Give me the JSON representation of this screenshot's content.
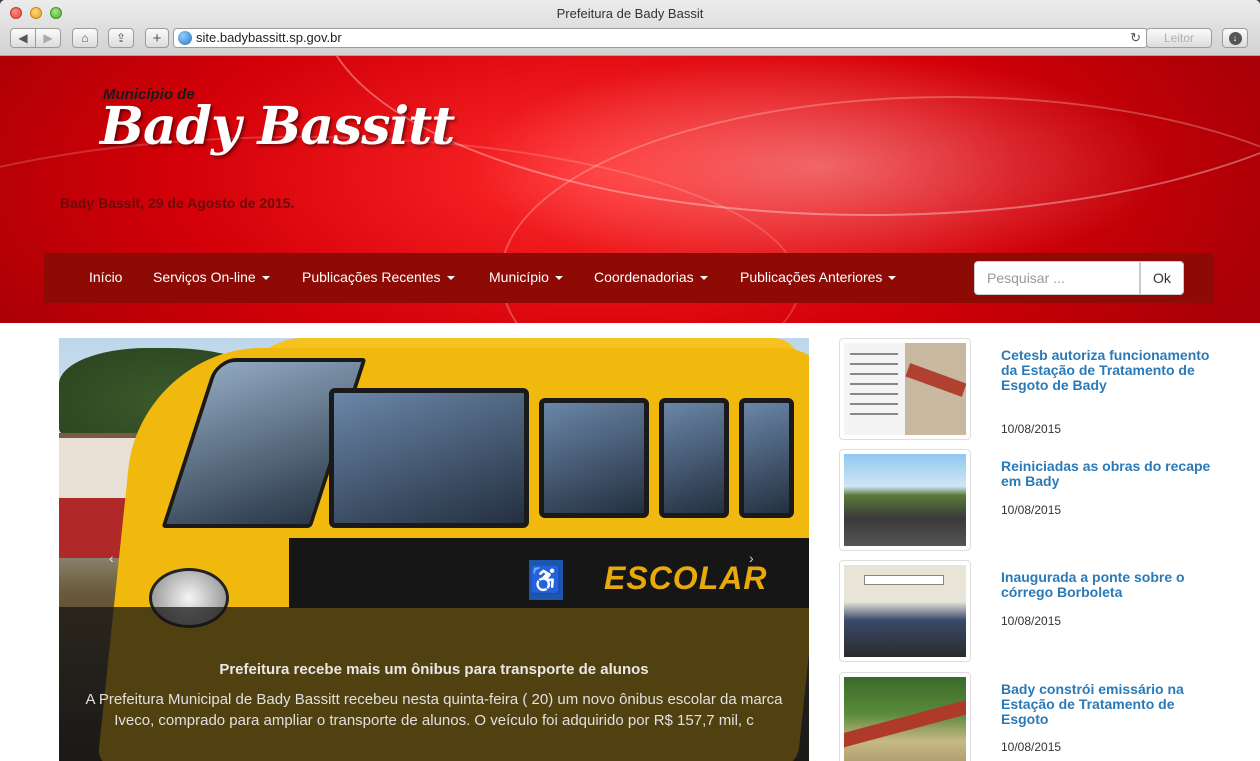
{
  "browser": {
    "window_title": "Prefeitura de Bady Bassit",
    "url": "site.badybassitt.sp.gov.br",
    "reader_label": "Leitor",
    "buttons": {
      "back": "◀",
      "forward": "▶",
      "home": "⌂",
      "share": "⇪",
      "add": "+",
      "reload": "↻",
      "download": "↓"
    }
  },
  "header": {
    "logo_small": "Município de",
    "logo_big": "Bady Bassitt",
    "date_line": "Bady Bassit, 29 de Agosto de 2015."
  },
  "nav": {
    "items": [
      {
        "label": "Início"
      },
      {
        "label": "Serviços On-line"
      },
      {
        "label": "Publicações Recentes"
      },
      {
        "label": "Município"
      },
      {
        "label": "Coordenadorias"
      },
      {
        "label": "Publicações Anteriores"
      }
    ],
    "search_placeholder": "Pesquisar ...",
    "search_button": "Ok"
  },
  "carousel": {
    "title": "Prefeitura recebe mais um ônibus para transporte de alunos",
    "text": "A Prefeitura Municipal de Bady Bassitt recebeu nesta quinta-feira ( 20) um novo ônibus escolar da marca Iveco, comprado para ampliar o transporte de alunos. O veículo foi adquirido por R$ 157,7 mil, c",
    "bus_label": "ESCOLAR",
    "prev": "‹",
    "next": "›"
  },
  "news": [
    {
      "title": "Cetesb autoriza funcionamento da Estação de Tratamento de Esgoto de Bady",
      "date": "10/08/2015"
    },
    {
      "title": "Reiniciadas as obras do recape em Bady",
      "date": "10/08/2015"
    },
    {
      "title": "Inaugurada a ponte sobre o córrego Borboleta",
      "date": "10/08/2015"
    },
    {
      "title": "Bady constrói emissário na Estação de Tratamento de Esgoto",
      "date": "10/08/2015"
    }
  ]
}
